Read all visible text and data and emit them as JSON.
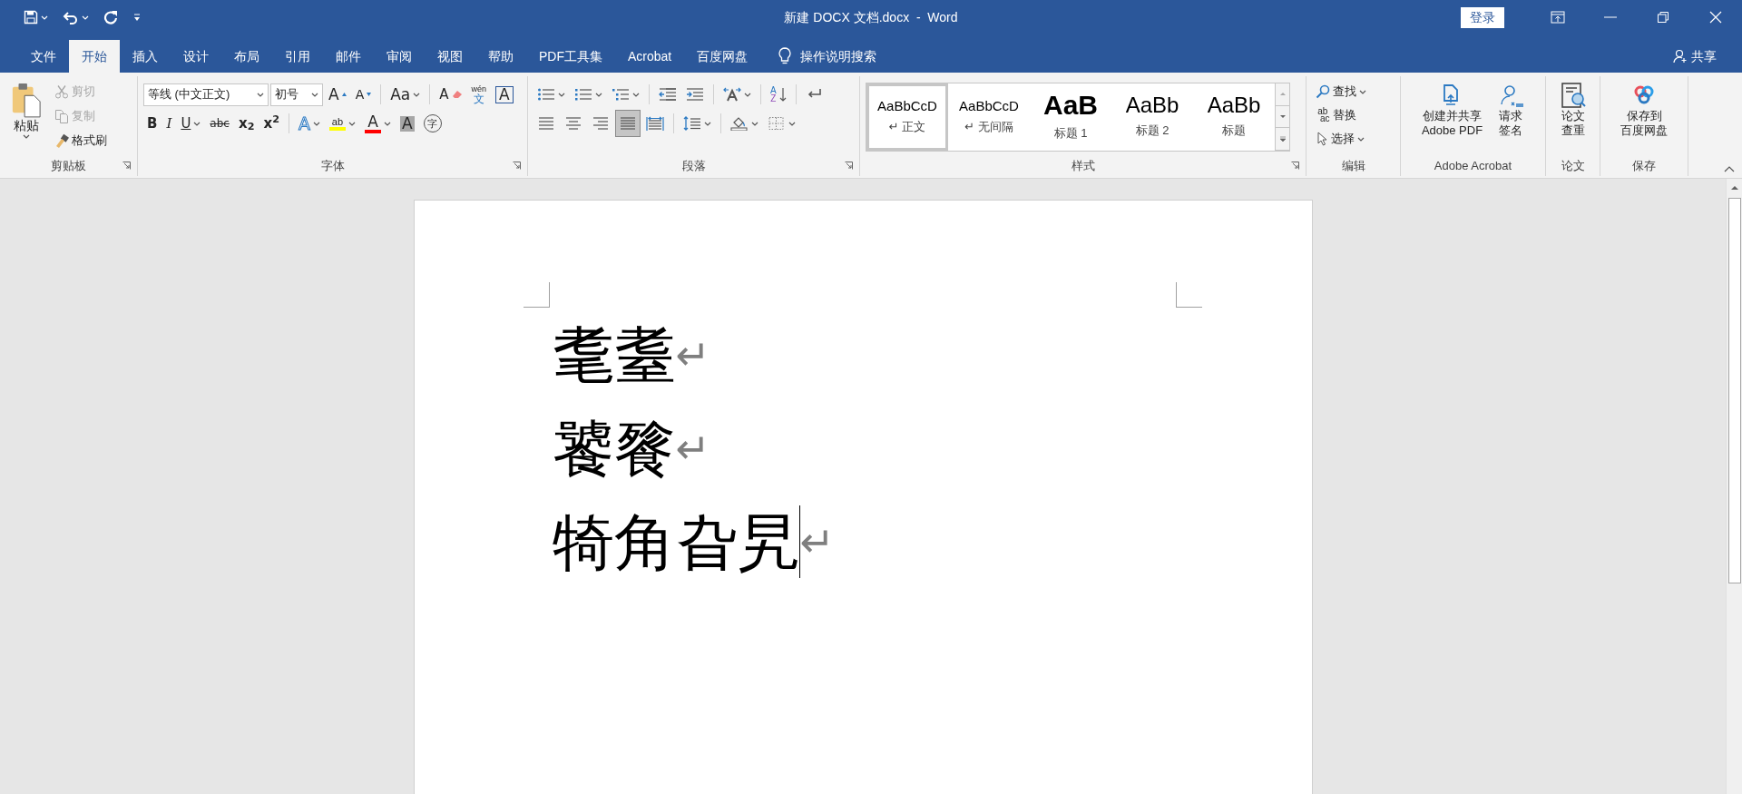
{
  "window": {
    "title": "新建 DOCX 文档.docx  -  Word",
    "sign_in": "登录"
  },
  "tabs": [
    {
      "label": "文件",
      "selected": false
    },
    {
      "label": "开始",
      "selected": true
    },
    {
      "label": "插入",
      "selected": false
    },
    {
      "label": "设计",
      "selected": false
    },
    {
      "label": "布局",
      "selected": false
    },
    {
      "label": "引用",
      "selected": false
    },
    {
      "label": "邮件",
      "selected": false
    },
    {
      "label": "审阅",
      "selected": false
    },
    {
      "label": "视图",
      "selected": false
    },
    {
      "label": "帮助",
      "selected": false
    },
    {
      "label": "PDF工具集",
      "selected": false
    },
    {
      "label": "Acrobat",
      "selected": false
    },
    {
      "label": "百度网盘",
      "selected": false
    }
  ],
  "tell_me": "操作说明搜索",
  "share": "共享",
  "clipboard": {
    "paste": "粘贴",
    "tools": [
      {
        "label": "剪切",
        "disabled": true
      },
      {
        "label": "复制",
        "disabled": true
      },
      {
        "label": "格式刷",
        "disabled": false
      }
    ],
    "group": "剪贴板"
  },
  "font": {
    "font_name": "等线 (中文正文)",
    "font_size": "初号",
    "grow": "A",
    "shrink": "A",
    "change_case": "Aa",
    "clear_format": "A",
    "pinyin": [
      "wén",
      "文"
    ],
    "char_border": "A",
    "bold": "B",
    "italic": "I",
    "underline": "U",
    "strikethrough": "abc",
    "subscript": "x$_{2}$",
    "superscript": "x$^{2}$",
    "text_effects": "A",
    "highlight": "ab",
    "font_color": "A",
    "char_shading": "A",
    "enclosed": "字",
    "group": "字体"
  },
  "paragraph": {
    "alignment": [
      {
        "selected": false
      },
      {
        "selected": false
      },
      {
        "selected": false
      },
      {
        "selected": true
      },
      {
        "selected": false
      }
    ],
    "sort": [
      "A",
      "Z"
    ],
    "group": "段落"
  },
  "styles": {
    "items": [
      {
        "preview": "AaBbCcD",
        "name": "↵ 正文",
        "selected": true
      },
      {
        "preview": "AaBbCcD",
        "name": "↵ 无间隔",
        "selected": false
      },
      {
        "preview": "AaB",
        "name": "标题 1",
        "selected": false
      },
      {
        "preview": "AaBb",
        "name": "标题 2",
        "selected": false
      },
      {
        "preview": "AaBb",
        "name": "标题",
        "selected": false
      }
    ],
    "group": "样式"
  },
  "editing": {
    "find": "查找",
    "replace": "替换",
    "replace_glyph": [
      "ab",
      "ac"
    ],
    "select": "选择",
    "group": "编辑"
  },
  "acrobat": {
    "buttons": [
      [
        "创建并共享",
        "Adobe PDF"
      ],
      [
        "请求",
        "签名"
      ]
    ],
    "group": "Adobe Acrobat"
  },
  "thesis": {
    "button": [
      "论文",
      "查重"
    ],
    "group": "论文"
  },
  "save": {
    "button": [
      "保存到",
      "百度网盘"
    ],
    "group": "保存"
  },
  "document": {
    "paragraphs": [
      {
        "text": "耄耋",
        "mark": "↵",
        "cursor": false
      },
      {
        "text": "饕餮",
        "mark": "↵",
        "cursor": false
      },
      {
        "text": "犄角旮旯",
        "mark": "↵",
        "cursor": true
      }
    ]
  }
}
